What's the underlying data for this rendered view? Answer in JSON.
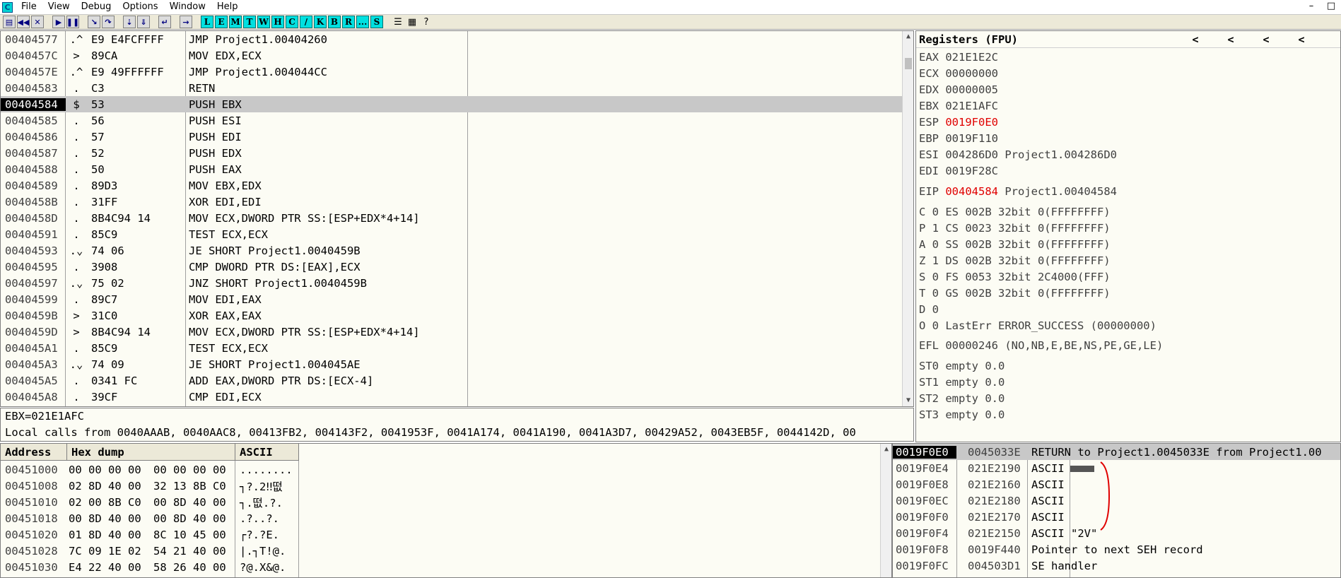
{
  "menubar": {
    "app_icon": "C",
    "items": [
      "File",
      "View",
      "Debug",
      "Options",
      "Window",
      "Help"
    ],
    "controls": [
      "–",
      "□"
    ]
  },
  "toolbar": {
    "letters": [
      "L",
      "E",
      "M",
      "T",
      "W",
      "H",
      "C",
      "/",
      "K",
      "B",
      "R",
      "...",
      "S"
    ]
  },
  "disasm": {
    "rows": [
      {
        "addr": "00404577",
        "mark": ".^",
        "hex": "E9 E4FCFFFF",
        "instr": "JMP Project1.00404260"
      },
      {
        "addr": "0040457C",
        "mark": ">",
        "hex": "89CA",
        "instr": "MOV EDX,ECX"
      },
      {
        "addr": "0040457E",
        "mark": ".^",
        "hex": "E9 49FFFFFF",
        "instr": "JMP Project1.004044CC"
      },
      {
        "addr": "00404583",
        "mark": ".",
        "hex": "C3",
        "instr": "RETN"
      },
      {
        "addr": "00404584",
        "mark": "$",
        "hex": "53",
        "instr": "PUSH EBX"
      },
      {
        "addr": "00404585",
        "mark": ".",
        "hex": "56",
        "instr": "PUSH ESI"
      },
      {
        "addr": "00404586",
        "mark": ".",
        "hex": "57",
        "instr": "PUSH EDI"
      },
      {
        "addr": "00404587",
        "mark": ".",
        "hex": "52",
        "instr": "PUSH EDX"
      },
      {
        "addr": "00404588",
        "mark": ".",
        "hex": "50",
        "instr": "PUSH EAX"
      },
      {
        "addr": "00404589",
        "mark": ".",
        "hex": "89D3",
        "instr": "MOV EBX,EDX"
      },
      {
        "addr": "0040458B",
        "mark": ".",
        "hex": "31FF",
        "instr": "XOR EDI,EDI"
      },
      {
        "addr": "0040458D",
        "mark": ".",
        "hex": "8B4C94 14",
        "instr": "MOV ECX,DWORD PTR SS:[ESP+EDX*4+14]"
      },
      {
        "addr": "00404591",
        "mark": ".",
        "hex": "85C9",
        "instr": "TEST ECX,ECX"
      },
      {
        "addr": "00404593",
        "mark": ".⌄",
        "hex": "74 06",
        "instr": "JE SHORT Project1.0040459B"
      },
      {
        "addr": "00404595",
        "mark": ".",
        "hex": "3908",
        "instr": "CMP DWORD PTR DS:[EAX],ECX"
      },
      {
        "addr": "00404597",
        "mark": ".⌄",
        "hex": "75 02",
        "instr": "JNZ SHORT Project1.0040459B"
      },
      {
        "addr": "00404599",
        "mark": ".",
        "hex": "89C7",
        "instr": "MOV EDI,EAX"
      },
      {
        "addr": "0040459B",
        "mark": ">",
        "hex": "31C0",
        "instr": "XOR EAX,EAX"
      },
      {
        "addr": "0040459D",
        "mark": ">",
        "hex": "8B4C94 14",
        "instr": "MOV ECX,DWORD PTR SS:[ESP+EDX*4+14]"
      },
      {
        "addr": "004045A1",
        "mark": ".",
        "hex": "85C9",
        "instr": "TEST ECX,ECX"
      },
      {
        "addr": "004045A3",
        "mark": ".⌄",
        "hex": "74 09",
        "instr": "JE SHORT Project1.004045AE"
      },
      {
        "addr": "004045A5",
        "mark": ".",
        "hex": "0341 FC",
        "instr": "ADD EAX,DWORD PTR DS:[ECX-4]"
      },
      {
        "addr": "004045A8",
        "mark": ".",
        "hex": "39CF",
        "instr": "CMP EDI,ECX"
      }
    ]
  },
  "registers": {
    "title": "Registers (FPU)",
    "arrows": [
      "<",
      "<",
      "<",
      "<"
    ],
    "lines": [
      {
        "name": "EAX",
        "value": "021E1E2C",
        "extra": "",
        "red": false
      },
      {
        "name": "ECX",
        "value": "00000000",
        "extra": "",
        "red": false
      },
      {
        "name": "EDX",
        "value": "00000005",
        "extra": "",
        "red": false
      },
      {
        "name": "EBX",
        "value": "021E1AFC",
        "extra": "",
        "red": false
      },
      {
        "name": "ESP",
        "value": "0019F0E0",
        "extra": "",
        "red": true
      },
      {
        "name": "EBP",
        "value": "0019F110",
        "extra": "",
        "red": false
      },
      {
        "name": "ESI",
        "value": "004286D0",
        "extra": "Project1.004286D0",
        "red": false
      },
      {
        "name": "EDI",
        "value": "0019F28C",
        "extra": "",
        "red": false
      }
    ],
    "eip": {
      "name": "EIP",
      "value": "00404584",
      "extra": "Project1.00404584"
    },
    "flags": [
      "C 0  ES 002B 32bit 0(FFFFFFFF)",
      "P 1  CS 0023 32bit 0(FFFFFFFF)",
      "A 0  SS 002B 32bit 0(FFFFFFFF)",
      "Z 1  DS 002B 32bit 0(FFFFFFFF)",
      "S 0  FS 0053 32bit 2C4000(FFF)",
      "T 0  GS 002B 32bit 0(FFFFFFFF)",
      "D 0",
      "O 0  LastErr ERROR_SUCCESS (00000000)"
    ],
    "efl": "EFL 00000246 (NO,NB,E,BE,NS,PE,GE,LE)",
    "fpu": [
      "ST0 empty 0.0",
      "ST1 empty 0.0",
      "ST2 empty 0.0",
      "ST3 empty 0.0"
    ]
  },
  "info": {
    "line1": "EBX=021E1AFC",
    "line2": "Local calls from 0040AAAB, 0040AAC8, 00413FB2, 004143F2, 0041953F, 0041A174, 0041A190, 0041A3D7, 00429A52, 0043EB5F, 0044142D, 00"
  },
  "dump": {
    "headers": {
      "address": "Address",
      "hex": "Hex dump",
      "ascii": "ASCII"
    },
    "rows": [
      {
        "addr": "00451000",
        "hex1": "00 00 00 00",
        "hex2": "00 00 00 00",
        "ascii": "........"
      },
      {
        "addr": "00451008",
        "hex1": "02 8D 40 00",
        "hex2": "32 13 8B C0",
        "ascii": "┐?.2‼떲"
      },
      {
        "addr": "00451010",
        "hex1": "02 00 8B C0",
        "hex2": "00 8D 40 00",
        "ascii": "┐.떲.?."
      },
      {
        "addr": "00451018",
        "hex1": "00 8D 40 00",
        "hex2": "00 8D 40 00",
        "ascii": ".?..?."
      },
      {
        "addr": "00451020",
        "hex1": "01 8D 40 00",
        "hex2": "8C 10 45 00",
        "ascii": "┌?.?E."
      },
      {
        "addr": "00451028",
        "hex1": "7C 09 1E 02",
        "hex2": "54 21 40 00",
        "ascii": "|.┐T!@."
      },
      {
        "addr": "00451030",
        "hex1": "E4 22 40 00",
        "hex2": "58 26 40 00",
        "ascii": "?@.X&@."
      }
    ]
  },
  "stack": {
    "rows": [
      {
        "addr": "0019F0E0",
        "val": "0045033E",
        "cmt": "RETURN to Project1.0045033E from Project1.00"
      },
      {
        "addr": "0019F0E4",
        "val": "021E2190",
        "cmt": "ASCII"
      },
      {
        "addr": "0019F0E8",
        "val": "021E2160",
        "cmt": "ASCII"
      },
      {
        "addr": "0019F0EC",
        "val": "021E2180",
        "cmt": "ASCII"
      },
      {
        "addr": "0019F0F0",
        "val": "021E2170",
        "cmt": "ASCII"
      },
      {
        "addr": "0019F0F4",
        "val": "021E2150",
        "cmt": "ASCII \"2V\""
      },
      {
        "addr": "0019F0F8",
        "val": "0019F440",
        "cmt": "Pointer to next SEH record"
      },
      {
        "addr": "0019F0FC",
        "val": "004503D1",
        "cmt": "SE handler"
      }
    ]
  }
}
